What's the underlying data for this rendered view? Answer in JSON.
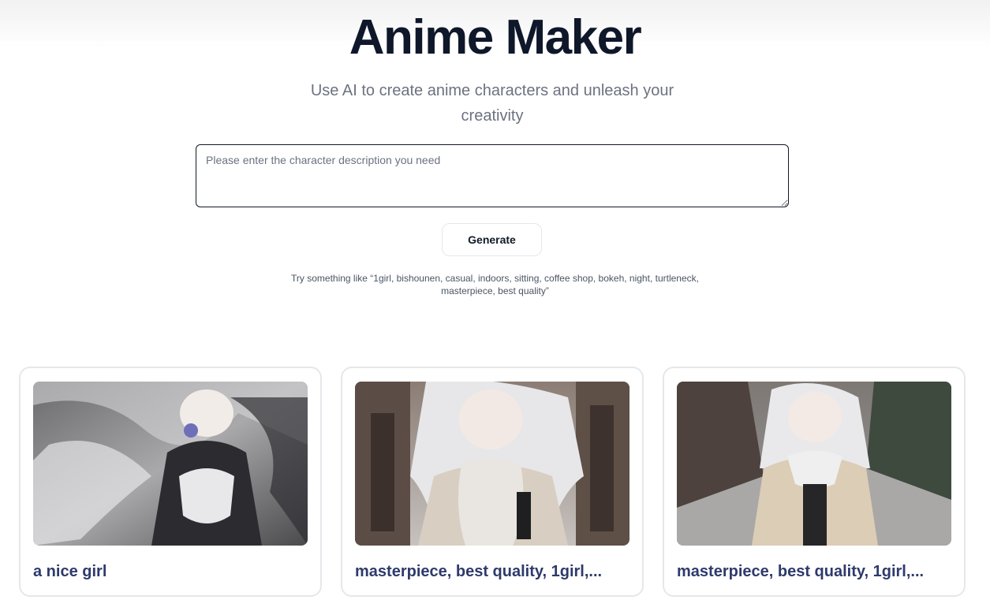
{
  "header": {
    "title": "Anime Maker",
    "subtitle": "Use AI to create anime characters and unleash your creativity"
  },
  "prompt": {
    "placeholder": "Please enter the character description you need",
    "value": ""
  },
  "generate_button": {
    "label": "Generate"
  },
  "hint": "Try something like “1girl, bishounen, casual, indoors, sitting, coffee shop, bokeh, night, turtleneck, masterpiece, best quality”",
  "gallery": [
    {
      "caption": "a nice girl"
    },
    {
      "caption": "masterpiece, best quality, 1girl,..."
    },
    {
      "caption": "masterpiece, best quality, 1girl,..."
    }
  ]
}
